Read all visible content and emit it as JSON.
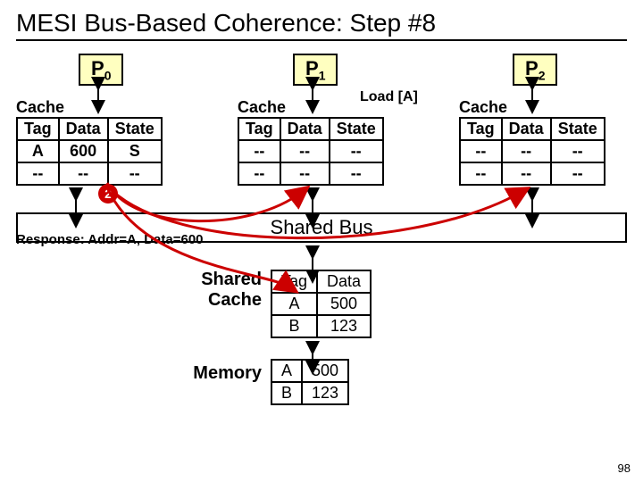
{
  "title": "MESI Bus-Based Coherence: Step #8",
  "processors": {
    "p0": "P",
    "p0sub": "0",
    "p1": "P",
    "p1sub": "1",
    "p2": "P",
    "p2sub": "2"
  },
  "cache_label": "Cache",
  "headers": {
    "tag": "Tag",
    "data": "Data",
    "state": "State"
  },
  "p0cache": {
    "r0": {
      "tag": "A",
      "data": "600",
      "state": "S"
    },
    "r1": {
      "tag": "--",
      "data": "--",
      "state": "--"
    }
  },
  "p1cache": {
    "r0": {
      "tag": "--",
      "data": "--",
      "state": "--"
    },
    "r1": {
      "tag": "--",
      "data": "--",
      "state": "--"
    }
  },
  "p2cache": {
    "r0": {
      "tag": "--",
      "data": "--",
      "state": "--"
    },
    "r1": {
      "tag": "--",
      "data": "--",
      "state": "--"
    }
  },
  "load_label": "Load [A]",
  "step_badge": "2",
  "bus_label": "Shared Bus",
  "response": "Response: Addr=A, Data=600",
  "shared_cache_label": "Shared\nCache",
  "memory_label": "Memory",
  "shared_cache": {
    "h": {
      "tag": "Tag",
      "data": "Data"
    },
    "r0": {
      "tag": "A",
      "data": "500"
    },
    "r1": {
      "tag": "B",
      "data": "123"
    }
  },
  "memory": {
    "r0": {
      "tag": "A",
      "data": "500"
    },
    "r1": {
      "tag": "B",
      "data": "123"
    }
  },
  "pagenum": "98"
}
